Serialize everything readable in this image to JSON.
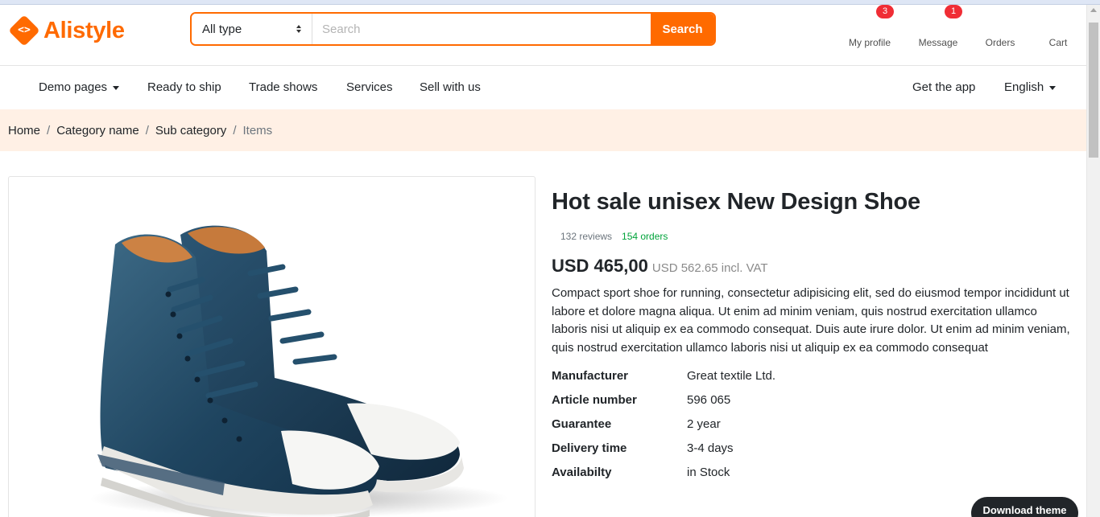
{
  "brand": {
    "name": "Alistyle",
    "logo_glyph": "<>",
    "accent_color": "#ff6a00"
  },
  "search": {
    "type_selected": "All type",
    "placeholder": "Search",
    "value": "",
    "button_label": "Search"
  },
  "header_widgets": [
    {
      "label": "My profile",
      "icon": "user-icon",
      "badge": "3"
    },
    {
      "label": "Message",
      "icon": "message-icon",
      "badge": "1"
    },
    {
      "label": "Orders",
      "icon": "heart-icon",
      "badge": ""
    },
    {
      "label": "Cart",
      "icon": "cart-icon",
      "badge": ""
    }
  ],
  "nav": {
    "left": [
      {
        "label": "Demo pages",
        "dropdown": true
      },
      {
        "label": "Ready to ship",
        "dropdown": false
      },
      {
        "label": "Trade shows",
        "dropdown": false
      },
      {
        "label": "Services",
        "dropdown": false
      },
      {
        "label": "Sell with us",
        "dropdown": false
      }
    ],
    "right": [
      {
        "label": "Get the app",
        "dropdown": false
      },
      {
        "label": "English",
        "dropdown": true
      }
    ]
  },
  "breadcrumb": [
    "Home",
    "Category name",
    "Sub category",
    "Items"
  ],
  "product": {
    "title": "Hot sale unisex New Design Shoe",
    "reviews": "132 reviews",
    "orders": "154 orders",
    "price": "USD 465,00",
    "price_note": "USD 562.65 incl. VAT",
    "description": "Compact sport shoe for running, consectetur adipisicing elit, sed do eiusmod tempor incididunt ut labore et dolore magna aliqua. Ut enim ad minim veniam, quis nostrud exercitation ullamco laboris nisi ut aliquip ex ea commodo consequat. Duis aute irure dolor. Ut enim ad minim veniam, quis nostrud exercitation ullamco laboris nisi ut aliquip ex ea commodo consequat",
    "specs": [
      {
        "key": "Manufacturer",
        "value": "Great textile Ltd."
      },
      {
        "key": "Article number",
        "value": "596 065"
      },
      {
        "key": "Guarantee",
        "value": "2 year"
      },
      {
        "key": "Delivery time",
        "value": "3-4 days"
      },
      {
        "key": "Availabilty",
        "value": "in Stock"
      }
    ],
    "image_icon": "shoe-image"
  },
  "floating_button": {
    "label": "Download theme"
  },
  "colors": {
    "accent": "#ff6a00",
    "breadcrumb_bg": "#fff0e5",
    "badge": "#f02d35",
    "orders_green": "#00a33a"
  }
}
